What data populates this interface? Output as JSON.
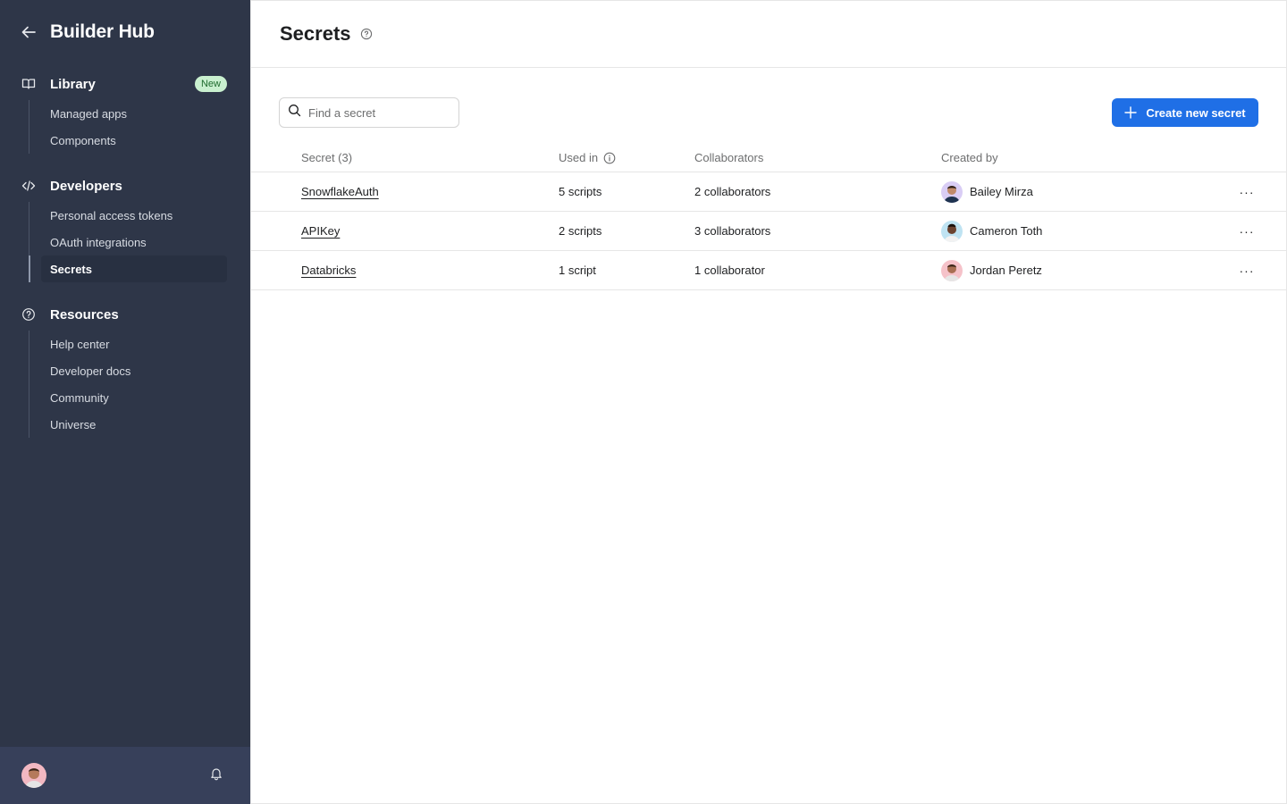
{
  "sidebar": {
    "title": "Builder Hub",
    "sections": [
      {
        "label": "Library",
        "badge": "New",
        "items": [
          "Managed apps",
          "Components"
        ]
      },
      {
        "label": "Developers",
        "items": [
          "Personal access tokens",
          "OAuth integrations",
          "Secrets"
        ],
        "active_item": "Secrets"
      },
      {
        "label": "Resources",
        "items": [
          "Help center",
          "Developer docs",
          "Community",
          "Universe"
        ]
      }
    ]
  },
  "page": {
    "title": "Secrets"
  },
  "search": {
    "placeholder": "Find a secret"
  },
  "create_button": {
    "label": "Create new secret"
  },
  "table": {
    "headers": {
      "secret": "Secret (3)",
      "used_in": "Used in",
      "collaborators": "Collaborators",
      "created_by": "Created by"
    },
    "rows": [
      {
        "secret": "SnowflakeAuth",
        "used_in": "5 scripts",
        "collaborators": "2 collaborators",
        "created_by": "Bailey Mirza"
      },
      {
        "secret": "APIKey",
        "used_in": "2 scripts",
        "collaborators": "3 collaborators",
        "created_by": "Cameron Toth"
      },
      {
        "secret": "Databricks",
        "used_in": "1 script",
        "collaborators": "1 collaborator",
        "created_by": "Jordan Peretz"
      }
    ],
    "more_label": "···"
  },
  "colors": {
    "sidebar_bg": "#2e3648",
    "primary": "#1f6fe6",
    "badge_bg": "#c9f0cf"
  }
}
